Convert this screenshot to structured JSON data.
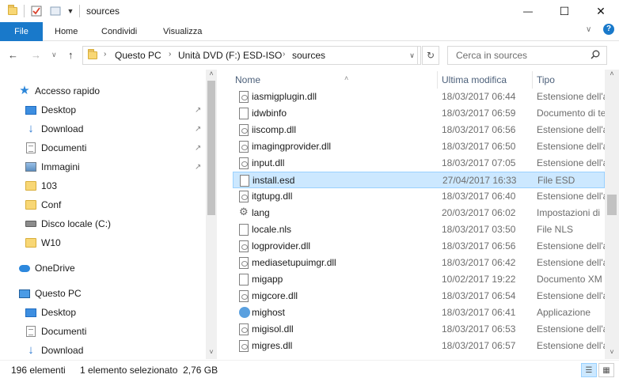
{
  "window": {
    "title": "sources",
    "minimize_glyph": "—",
    "maximize_glyph": "☐",
    "close_glyph": "✕"
  },
  "ribbon": {
    "tabs": [
      "File",
      "Home",
      "Condividi",
      "Visualizza"
    ],
    "expand_glyph": "∨",
    "help_glyph": "?"
  },
  "nav": {
    "back_glyph": "←",
    "forward_glyph": "→",
    "recent_glyph": "∨",
    "up_glyph": "↑",
    "breadcrumb": [
      "Questo PC",
      "Unità DVD (F:) ESD-ISO",
      "sources"
    ],
    "refresh_glyph": "↻",
    "dropdown_glyph": "∨"
  },
  "search": {
    "placeholder": "Cerca in sources"
  },
  "navpane": {
    "items": [
      {
        "label": "Accesso rapido",
        "icon": "star-icon",
        "pinned": false
      },
      {
        "label": "Desktop",
        "icon": "desktop-icon",
        "pinned": true
      },
      {
        "label": "Download",
        "icon": "download-icon",
        "pinned": true
      },
      {
        "label": "Documenti",
        "icon": "documents-icon",
        "pinned": true
      },
      {
        "label": "Immagini",
        "icon": "pictures-icon",
        "pinned": true
      },
      {
        "label": "103",
        "icon": "folder-icon",
        "pinned": false
      },
      {
        "label": "Conf",
        "icon": "folder-icon",
        "pinned": false
      },
      {
        "label": "Disco locale (C:)",
        "icon": "drive-icon",
        "pinned": false
      },
      {
        "label": "W10",
        "icon": "folder-icon",
        "pinned": false
      },
      {
        "label": "OneDrive",
        "icon": "onedrive-icon",
        "pinned": false
      },
      {
        "label": "Questo PC",
        "icon": "pc-icon",
        "pinned": false
      },
      {
        "label": "Desktop",
        "icon": "desktop-icon",
        "pinned": false
      },
      {
        "label": "Documenti",
        "icon": "documents-icon",
        "pinned": false
      },
      {
        "label": "Download",
        "icon": "download-icon",
        "pinned": false
      }
    ],
    "pin_glyph": "↗"
  },
  "list": {
    "columns": {
      "name": "Nome",
      "date": "Ultima modifica",
      "type": "Tipo"
    },
    "sort_glyph": "˄",
    "rows": [
      {
        "name": "iasmigplugin.dll",
        "date": "18/03/2017 06:44",
        "type": "Estensione dell'a",
        "icon": "dll",
        "selected": false
      },
      {
        "name": "idwbinfo",
        "date": "18/03/2017 06:59",
        "type": "Documento di te",
        "icon": "doc",
        "selected": false
      },
      {
        "name": "iiscomp.dll",
        "date": "18/03/2017 06:56",
        "type": "Estensione dell'a",
        "icon": "dll",
        "selected": false
      },
      {
        "name": "imagingprovider.dll",
        "date": "18/03/2017 06:50",
        "type": "Estensione dell'a",
        "icon": "dll",
        "selected": false
      },
      {
        "name": "input.dll",
        "date": "18/03/2017 07:05",
        "type": "Estensione dell'a",
        "icon": "dll",
        "selected": false
      },
      {
        "name": "install.esd",
        "date": "27/04/2017 16:33",
        "type": "File ESD",
        "icon": "doc",
        "selected": true
      },
      {
        "name": "itgtupg.dll",
        "date": "18/03/2017 06:40",
        "type": "Estensione dell'a",
        "icon": "dll",
        "selected": false
      },
      {
        "name": "lang",
        "date": "20/03/2017 06:02",
        "type": "Impostazioni di",
        "icon": "gear",
        "selected": false
      },
      {
        "name": "locale.nls",
        "date": "18/03/2017 03:50",
        "type": "File NLS",
        "icon": "doc",
        "selected": false
      },
      {
        "name": "logprovider.dll",
        "date": "18/03/2017 06:56",
        "type": "Estensione dell'a",
        "icon": "dll",
        "selected": false
      },
      {
        "name": "mediasetupuimgr.dll",
        "date": "18/03/2017 06:42",
        "type": "Estensione dell'a",
        "icon": "dll",
        "selected": false
      },
      {
        "name": "migapp",
        "date": "10/02/2017 19:22",
        "type": "Documento XM",
        "icon": "doc",
        "selected": false
      },
      {
        "name": "migcore.dll",
        "date": "18/03/2017 06:54",
        "type": "Estensione dell'a",
        "icon": "dll",
        "selected": false
      },
      {
        "name": "mighost",
        "date": "18/03/2017 06:41",
        "type": "Applicazione",
        "icon": "app",
        "selected": false
      },
      {
        "name": "migisol.dll",
        "date": "18/03/2017 06:53",
        "type": "Estensione dell'a",
        "icon": "dll",
        "selected": false
      },
      {
        "name": "migres.dll",
        "date": "18/03/2017 06:57",
        "type": "Estensione dell'a",
        "icon": "dll",
        "selected": false
      }
    ]
  },
  "status": {
    "count": "196 elementi",
    "selection": "1 elemento selezionato  2,76 GB"
  }
}
